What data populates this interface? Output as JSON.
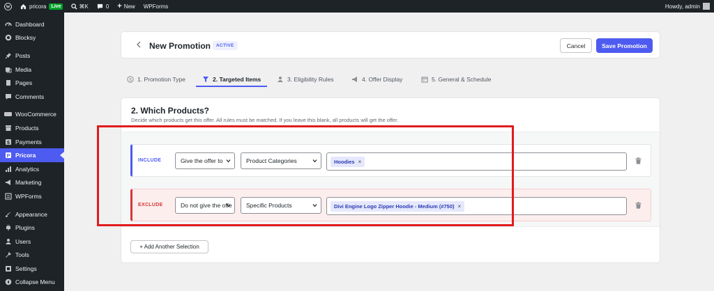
{
  "adminbar": {
    "site_name": "pricora",
    "live_badge": "Live",
    "shortcut": "⌘K",
    "comments_count": "0",
    "new_label": "New",
    "wpforms_label": "WPForms",
    "howdy": "Howdy, admin"
  },
  "sidebar": {
    "items": [
      {
        "label": "Dashboard",
        "icon": "dashboard-icon"
      },
      {
        "label": "Blocksy",
        "icon": "blocksy-icon"
      },
      {
        "label": "Posts",
        "icon": "pin-icon"
      },
      {
        "label": "Media",
        "icon": "media-icon"
      },
      {
        "label": "Pages",
        "icon": "page-icon"
      },
      {
        "label": "Comments",
        "icon": "comment-icon"
      },
      {
        "label": "WooCommerce",
        "icon": "woocommerce-icon"
      },
      {
        "label": "Products",
        "icon": "archive-icon"
      },
      {
        "label": "Payments",
        "icon": "payments-icon"
      },
      {
        "label": "Pricora",
        "icon": "pricora-icon"
      },
      {
        "label": "Analytics",
        "icon": "bar-chart-icon"
      },
      {
        "label": "Marketing",
        "icon": "megaphone-icon"
      },
      {
        "label": "WPForms",
        "icon": "forms-icon"
      },
      {
        "label": "Appearance",
        "icon": "brush-icon"
      },
      {
        "label": "Plugins",
        "icon": "plug-icon"
      },
      {
        "label": "Users",
        "icon": "users-icon"
      },
      {
        "label": "Tools",
        "icon": "wrench-icon"
      },
      {
        "label": "Settings",
        "icon": "settings-icon"
      },
      {
        "label": "Collapse Menu",
        "icon": "collapse-icon"
      }
    ]
  },
  "header": {
    "title": "New Promotion",
    "status": "ACTIVE",
    "cancel_label": "Cancel",
    "save_label": "Save Promotion"
  },
  "tabs": [
    {
      "label": "1. Promotion Type",
      "icon": "dollar-circle-icon"
    },
    {
      "label": "2. Targeted Items",
      "icon": "filter-icon"
    },
    {
      "label": "3. Eligibility Rules",
      "icon": "user-icon"
    },
    {
      "label": "4. Offer Display",
      "icon": "megaphone-icon"
    },
    {
      "label": "5. General & Schedule",
      "icon": "calendar-icon"
    }
  ],
  "active_tab": "2. Targeted Items",
  "section": {
    "title": "2. Which Products?",
    "description": "Decide which products get this offer. All rules must be matched. If you leave this blank, all products will get the offer."
  },
  "rules": [
    {
      "type": "INCLUDE",
      "condition": "Give the offer to",
      "scope": "Product Categories",
      "tokens": [
        "Hoodies"
      ]
    },
    {
      "type": "EXCLUDE",
      "condition": "Do not give the offe",
      "scope": "Specific Products",
      "tokens": [
        "Divi Engine Logo Zipper Hoodie - Medium (#750)"
      ]
    }
  ],
  "add_selection_label": "+ Add Another Selection",
  "colors": {
    "accent": "#4d5bf0",
    "exclude": "#d63638",
    "highlight": "#e01b1b",
    "wp_dark": "#1d2327"
  }
}
